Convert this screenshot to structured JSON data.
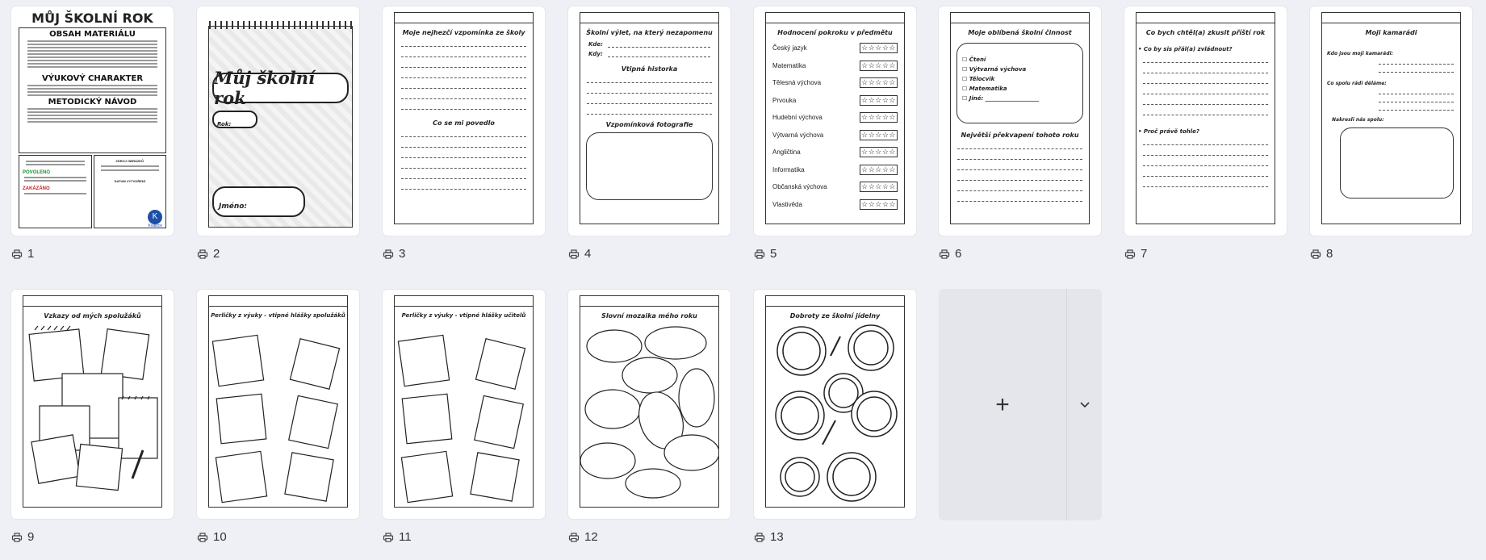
{
  "pages": [
    {
      "number": "1",
      "title": "MŮJ ŠKOLNÍ ROK",
      "h1": "OBSAH MATERIÁLU",
      "h2": "VÝUKOVÝ CHARAKTER",
      "h3": "METODICKÝ NÁVOD",
      "ok": "POVOLENO",
      "no": "ZAKÁZÁNO",
      "brand": "Kvalitce",
      "b1": "ZDROJ OBRÁZKŮ",
      "b2": "DATUM VYTVOŘENÍ"
    },
    {
      "number": "2",
      "title": "Můj školní rok",
      "year_label": "Rok:",
      "name_label": "Jméno:"
    },
    {
      "number": "3",
      "title": "Moje nejhezčí vzpomínka ze školy",
      "sub": "Co se mi povedlo"
    },
    {
      "number": "4",
      "title": "Školní výlet, na který nezapomenu",
      "where": "Kde:",
      "when": "Kdy:",
      "story": "Vtipná historka",
      "photo": "Vzpomínková fotografie"
    },
    {
      "number": "5",
      "title": "Hodnocení pokroku v předmětu",
      "subjects": [
        "Český jazyk",
        "Matematika",
        "Tělesná výchova",
        "Prvouka",
        "Hudební výchova",
        "Výtvarná výchova",
        "Angličtina",
        "Informatika",
        "Občanská výchova",
        "Vlastivěda"
      ],
      "stars": "☆☆☆☆☆"
    },
    {
      "number": "6",
      "title": "Moje oblíbená školní činnost",
      "options": [
        "☐ Čtení",
        "☐ Výtvarná výchova",
        "☐ Tělocvik",
        "☐ Matematika",
        "☐ Jiné: ___________________"
      ],
      "sub": "Největší překvapení tohoto roku"
    },
    {
      "number": "7",
      "title": "Co bych chtěl(a) zkusit příští rok",
      "q1": "• Co by sis přál(a) zvládnout?",
      "q2": "• Proč právě tohle?"
    },
    {
      "number": "8",
      "title": "Moji kamarádi",
      "q1": "Kdo jsou moji kamarádi:",
      "q2": "Co spolu rádi děláme:",
      "q3": "Nakresli nás spolu:"
    },
    {
      "number": "9",
      "title": "Vzkazy od mých spolužáků"
    },
    {
      "number": "10",
      "title": "Perličky z výuky - vtipné hlášky spolužáků"
    },
    {
      "number": "11",
      "title": "Perličky z výuky - vtipné hlášky učitelů"
    },
    {
      "number": "12",
      "title": "Slovní mozaika mého roku"
    },
    {
      "number": "13",
      "title": "Dobroty ze školní jídelny"
    }
  ],
  "add_tile": {
    "plus": "+"
  }
}
